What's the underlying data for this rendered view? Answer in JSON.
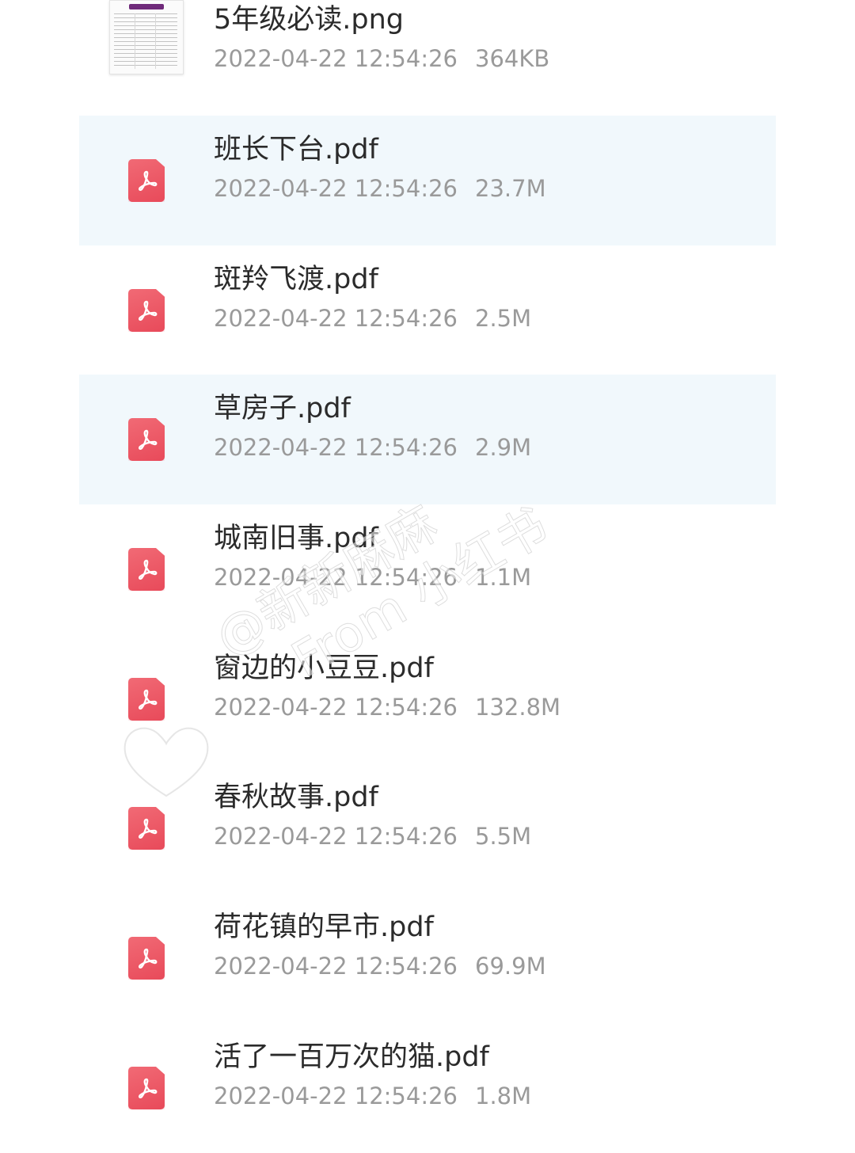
{
  "files": [
    {
      "name": "5年级必读.png",
      "date": "2022-04-22 12:54:26",
      "size": "364KB",
      "type": "image",
      "highlighted": false
    },
    {
      "name": "班长下台.pdf",
      "date": "2022-04-22 12:54:26",
      "size": "23.7M",
      "type": "pdf",
      "highlighted": true
    },
    {
      "name": "斑羚飞渡.pdf",
      "date": "2022-04-22 12:54:26",
      "size": "2.5M",
      "type": "pdf",
      "highlighted": false
    },
    {
      "name": "草房子.pdf",
      "date": "2022-04-22 12:54:26",
      "size": "2.9M",
      "type": "pdf",
      "highlighted": true
    },
    {
      "name": "城南旧事.pdf",
      "date": "2022-04-22 12:54:26",
      "size": "1.1M",
      "type": "pdf",
      "highlighted": false
    },
    {
      "name": "窗边的小豆豆.pdf",
      "date": "2022-04-22 12:54:26",
      "size": "132.8M",
      "type": "pdf",
      "highlighted": false
    },
    {
      "name": "春秋故事.pdf",
      "date": "2022-04-22 12:54:26",
      "size": "5.5M",
      "type": "pdf",
      "highlighted": false
    },
    {
      "name": "荷花镇的早市.pdf",
      "date": "2022-04-22 12:54:26",
      "size": "69.9M",
      "type": "pdf",
      "highlighted": false
    },
    {
      "name": "活了一百万次的猫.pdf",
      "date": "2022-04-22 12:54:26",
      "size": "1.8M",
      "type": "pdf",
      "highlighted": false
    }
  ],
  "watermark": {
    "line1": "@新新麻麻",
    "line2": "From 小红书"
  },
  "colors": {
    "highlight_row": "#f1f8fc",
    "pdf_icon": "#e84a5a",
    "name_text": "#2b2b2b",
    "meta_text": "#9a9a9a"
  },
  "icons": {
    "image_file": "image-thumbnail-icon",
    "pdf_file": "pdf-file-icon"
  }
}
